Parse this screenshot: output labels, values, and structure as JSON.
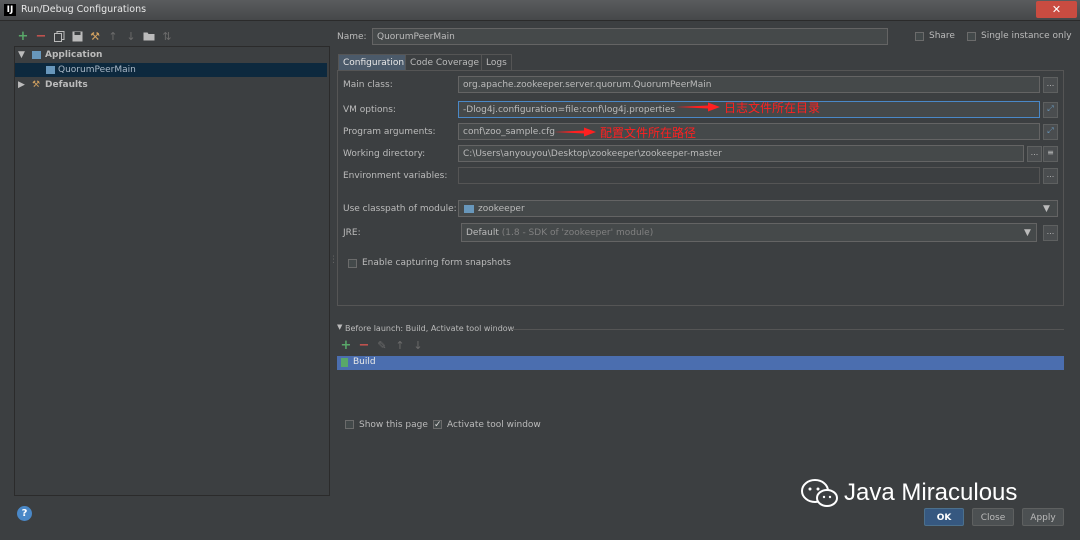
{
  "window": {
    "title": "Run/Debug Configurations",
    "app_icon": "IJ",
    "close": "✕"
  },
  "toolbar": {
    "icons": [
      "add-icon",
      "remove-icon",
      "copy-icon",
      "save-icon",
      "wrench-icon",
      "move-up-icon",
      "move-down-icon",
      "folder-icon",
      "sort-icon"
    ]
  },
  "tree": {
    "application": "Application",
    "config": "QuorumPeerMain",
    "defaults": "Defaults"
  },
  "header": {
    "name_label": "Name:",
    "name_value": "QuorumPeerMain",
    "share": "Share",
    "single_instance": "Single instance only"
  },
  "tabs": [
    "Configuration",
    "Code Coverage",
    "Logs"
  ],
  "form": {
    "main_class_label": "Main class:",
    "main_class_value": "org.apache.zookeeper.server.quorum.QuorumPeerMain",
    "vm_options_label": "VM options:",
    "vm_options_value": "-Dlog4j.configuration=file:conf\\log4j.properties",
    "program_args_label": "Program arguments:",
    "program_args_value": "conf\\zoo_sample.cfg",
    "working_dir_label": "Working directory:",
    "working_dir_value": "C:\\Users\\anyouyou\\Desktop\\zookeeper\\zookeeper-master",
    "env_vars_label": "Environment variables:",
    "env_vars_value": "",
    "classpath_label": "Use classpath of module:",
    "classpath_value": "zookeeper",
    "jre_label": "JRE:",
    "jre_value": "Default",
    "jre_hint": "(1.8 - SDK of 'zookeeper' module)",
    "capture_snapshots": "Enable capturing form snapshots"
  },
  "annotations": {
    "vm": "日志文件所在目录",
    "args": "配置文件所在路径"
  },
  "before_launch": {
    "title": "Before launch: Build, Activate tool window",
    "item": "Build"
  },
  "footer": {
    "show_page": "Show this page",
    "activate_tool": "Activate tool window"
  },
  "buttons": {
    "ok": "OK",
    "close": "Close",
    "apply": "Apply",
    "help": "?"
  },
  "watermark": "Java Miraculous",
  "colors": {
    "background": "#3c3f41",
    "selection": "#4b6eaf",
    "annotation": "#ff2020",
    "add": "#59a869",
    "remove": "#c75450"
  }
}
